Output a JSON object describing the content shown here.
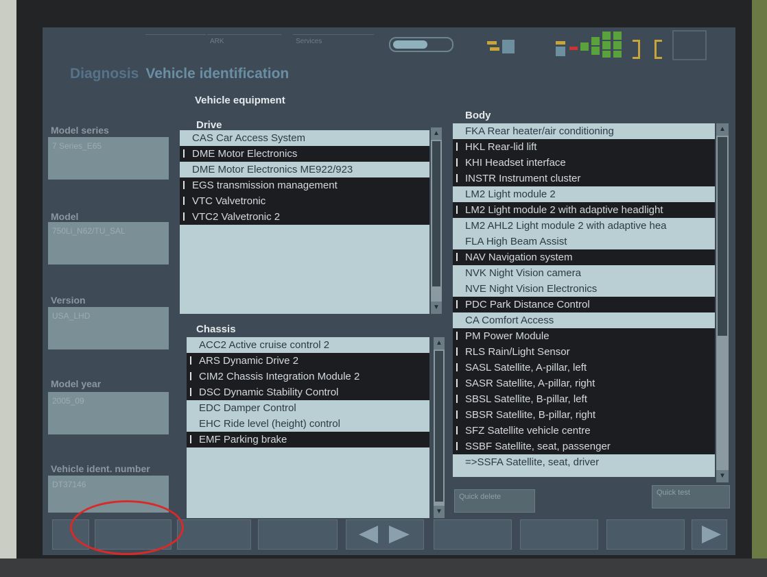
{
  "header": {
    "tabs": [
      "",
      "ARK",
      "Services"
    ],
    "title_breadcrumb": "Diagnosis",
    "title": "Vehicle identification"
  },
  "equipment_title": "Vehicle equipment",
  "sidebar": {
    "fields": [
      {
        "label": "Model series",
        "value": "7 Series_E65"
      },
      {
        "label": "Model",
        "value": "750Li_N62/TU_SAL"
      },
      {
        "label": "Version",
        "value": "USA_LHD"
      },
      {
        "label": "Model year",
        "value": "2005_09"
      },
      {
        "label": "Vehicle ident. number",
        "value": "DT37146"
      }
    ]
  },
  "drive": {
    "label": "Drive",
    "items": [
      {
        "text": "CAS Car Access System",
        "dark": false
      },
      {
        "text": "DME Motor Electronics",
        "dark": true
      },
      {
        "text": "DME Motor Electronics ME922/923",
        "dark": false
      },
      {
        "text": "EGS transmission management",
        "dark": true
      },
      {
        "text": "VTC Valvetronic",
        "dark": true
      },
      {
        "text": "VTC2 Valvetronic 2",
        "dark": true
      }
    ]
  },
  "chassis": {
    "label": "Chassis",
    "items": [
      {
        "text": "ACC2 Active cruise control 2",
        "dark": false
      },
      {
        "text": "ARS Dynamic Drive 2",
        "dark": true
      },
      {
        "text": "CIM2 Chassis Integration Module 2",
        "dark": true
      },
      {
        "text": "DSC Dynamic Stability Control",
        "dark": true
      },
      {
        "text": "EDC Damper Control",
        "dark": false
      },
      {
        "text": "EHC Ride level (height) control",
        "dark": false
      },
      {
        "text": "EMF Parking brake",
        "dark": true
      }
    ]
  },
  "body": {
    "label": "Body",
    "items": [
      {
        "text": "FKA Rear heater/air conditioning",
        "dark": false
      },
      {
        "text": "HKL Rear-lid lift",
        "dark": true
      },
      {
        "text": "KHI Headset interface",
        "dark": true
      },
      {
        "text": "INSTR Instrument cluster",
        "dark": true
      },
      {
        "text": "LM2 Light module 2",
        "dark": false
      },
      {
        "text": "LM2 Light module 2 with adaptive headlight",
        "dark": true
      },
      {
        "text": "LM2 AHL2 Light module 2 with adaptive hea",
        "dark": false
      },
      {
        "text": "FLA High Beam Assist",
        "dark": false
      },
      {
        "text": "NAV Navigation system",
        "dark": true
      },
      {
        "text": "NVK Night Vision camera",
        "dark": false
      },
      {
        "text": "NVE Night Vision Electronics",
        "dark": false
      },
      {
        "text": "PDC Park Distance Control",
        "dark": true
      },
      {
        "text": "CA Comfort Access",
        "dark": false
      },
      {
        "text": "PM Power Module",
        "dark": true
      },
      {
        "text": "RLS Rain/Light Sensor",
        "dark": true
      },
      {
        "text": "SASL Satellite, A-pillar, left",
        "dark": true
      },
      {
        "text": "SASR Satellite, A-pillar, right",
        "dark": true
      },
      {
        "text": "SBSL Satellite, B-pillar, left",
        "dark": true
      },
      {
        "text": "SBSR Satellite, B-pillar, right",
        "dark": true
      },
      {
        "text": "SFZ Satellite vehicle centre",
        "dark": true
      },
      {
        "text": "SSBF Satellite, seat, passenger",
        "dark": true
      },
      {
        "text": "=>SSFA Satellite, seat, driver",
        "dark": false
      }
    ]
  },
  "buttons": {
    "quick_delete": "Quick delete",
    "quick_test": "Quick test"
  },
  "colors": {
    "screen_bg": "#3e4a55",
    "list_bg": "#b9cfd4",
    "row_dark": "#1b1d20",
    "highlight_ring": "#d92a2a"
  },
  "icons": [
    "pill-toggle-icon",
    "status-indicator-icon",
    "bracket-icon",
    "arrow-left-icon",
    "arrow-right-icon"
  ]
}
